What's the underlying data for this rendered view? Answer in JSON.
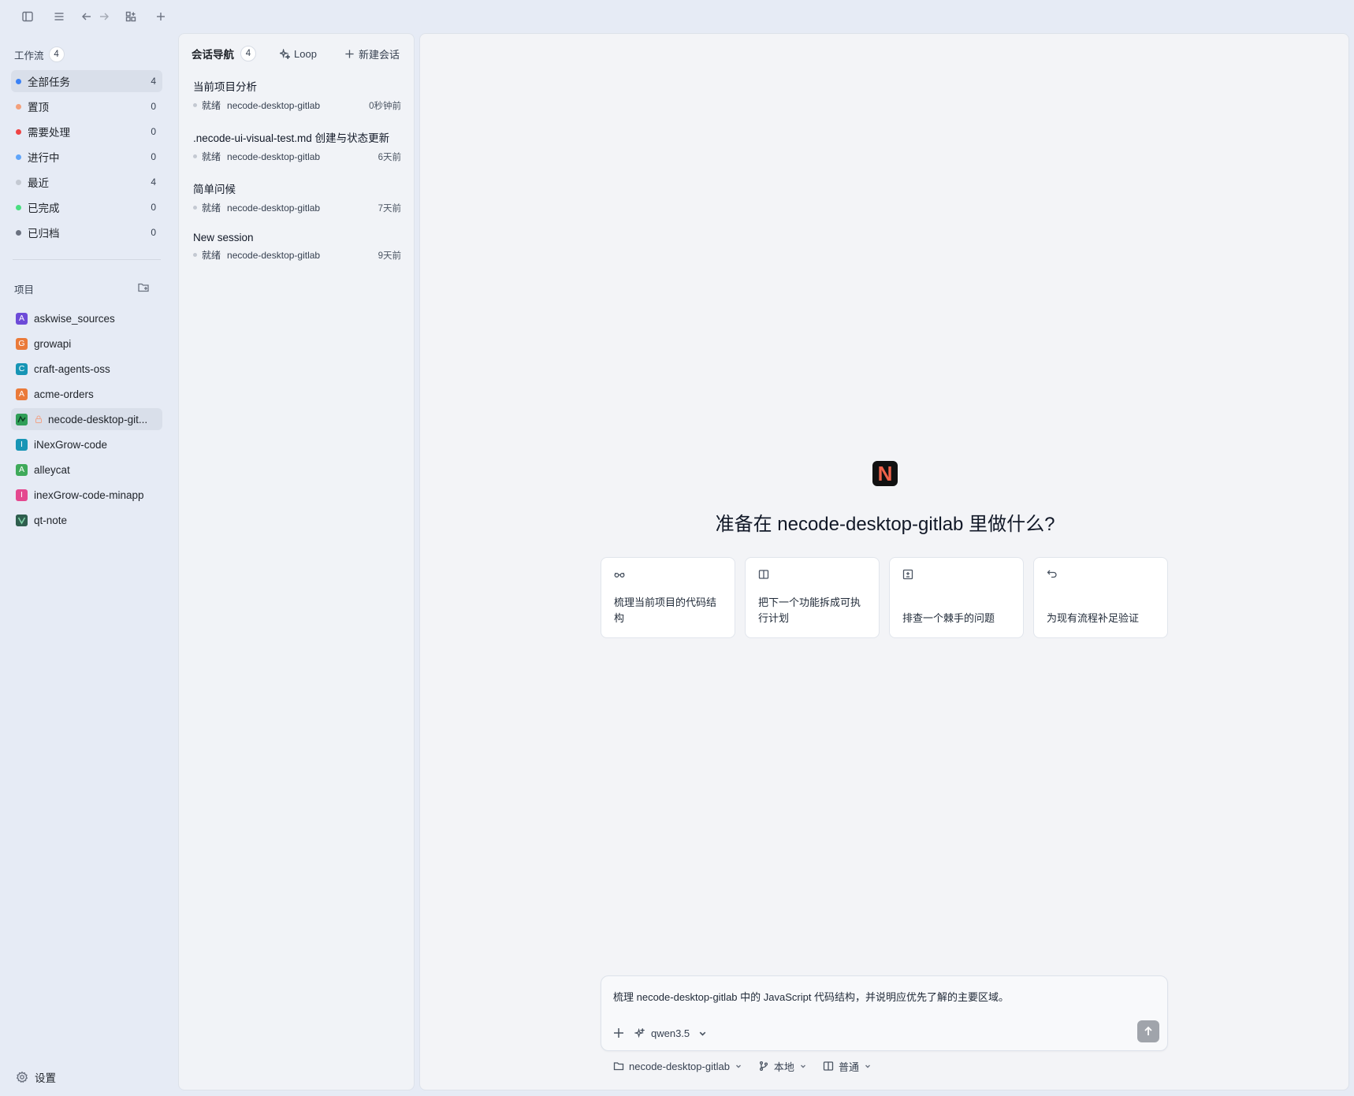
{
  "sidebar": {
    "workflow_title": "工作流",
    "workflow_count": "4",
    "workflows": [
      {
        "label": "全部任务",
        "count": "4",
        "color": "#3b82f6"
      },
      {
        "label": "置顶",
        "count": "0",
        "color": "#f3a07c"
      },
      {
        "label": "需要处理",
        "count": "0",
        "color": "#ef4444"
      },
      {
        "label": "进行中",
        "count": "0",
        "color": "#60a5fa"
      },
      {
        "label": "最近",
        "count": "4",
        "color": "#c4c9d2"
      },
      {
        "label": "已完成",
        "count": "0",
        "color": "#4ade80"
      },
      {
        "label": "已归档",
        "count": "0",
        "color": "#6b7280"
      }
    ],
    "projects_title": "项目",
    "projects": [
      {
        "label": "askwise_sources",
        "letter": "A",
        "color": "#6d4bd8"
      },
      {
        "label": "growapi",
        "letter": "G",
        "color": "#ea7a3a"
      },
      {
        "label": "craft-agents-oss",
        "letter": "C",
        "color": "#1795b5"
      },
      {
        "label": "acme-orders",
        "letter": "A",
        "color": "#ea7a3a"
      },
      {
        "label": "necode-desktop-git...",
        "letter": "",
        "color": "#2f9e57"
      },
      {
        "label": "iNexGrow-code",
        "letter": "I",
        "color": "#1795b5"
      },
      {
        "label": "alleycat",
        "letter": "A",
        "color": "#3faa5a"
      },
      {
        "label": "inexGrow-code-minapp",
        "letter": "I",
        "color": "#e4488f"
      },
      {
        "label": "qt-note",
        "letter": "",
        "color": "#2f5e4e"
      }
    ],
    "settings_label": "设置"
  },
  "sessions": {
    "title": "会话导航",
    "count": "4",
    "loop_label": "Loop",
    "new_label": "新建会话",
    "items": [
      {
        "name": "当前项目分析",
        "status": "就绪",
        "project": "necode-desktop-gitlab",
        "time": "0秒钟前"
      },
      {
        "name": ".necode-ui-visual-test.md 创建与状态更新",
        "status": "就绪",
        "project": "necode-desktop-gitlab",
        "time": "6天前"
      },
      {
        "name": "简单问候",
        "status": "就绪",
        "project": "necode-desktop-gitlab",
        "time": "7天前"
      },
      {
        "name": "New session",
        "status": "就绪",
        "project": "necode-desktop-gitlab",
        "time": "9天前"
      }
    ]
  },
  "main": {
    "logo_letter": "N",
    "hero_title": "准备在 necode-desktop-gitlab 里做什么?",
    "cards": [
      {
        "text": "梳理当前项目的代码结构",
        "icon": "glasses-icon"
      },
      {
        "text": "把下一个功能拆成可执行计划",
        "icon": "book-icon"
      },
      {
        "text": "排查一个棘手的问题",
        "icon": "plus-square-icon"
      },
      {
        "text": "为现有流程补足验证",
        "icon": "undo-icon"
      }
    ],
    "composer_text": "梳理 necode-desktop-gitlab 中的 JavaScript 代码结构，并说明应优先了解的主要区域。",
    "model": "qwen3.5",
    "bottom": {
      "project": "necode-desktop-gitlab",
      "branch": "本地",
      "mode": "普通"
    }
  }
}
